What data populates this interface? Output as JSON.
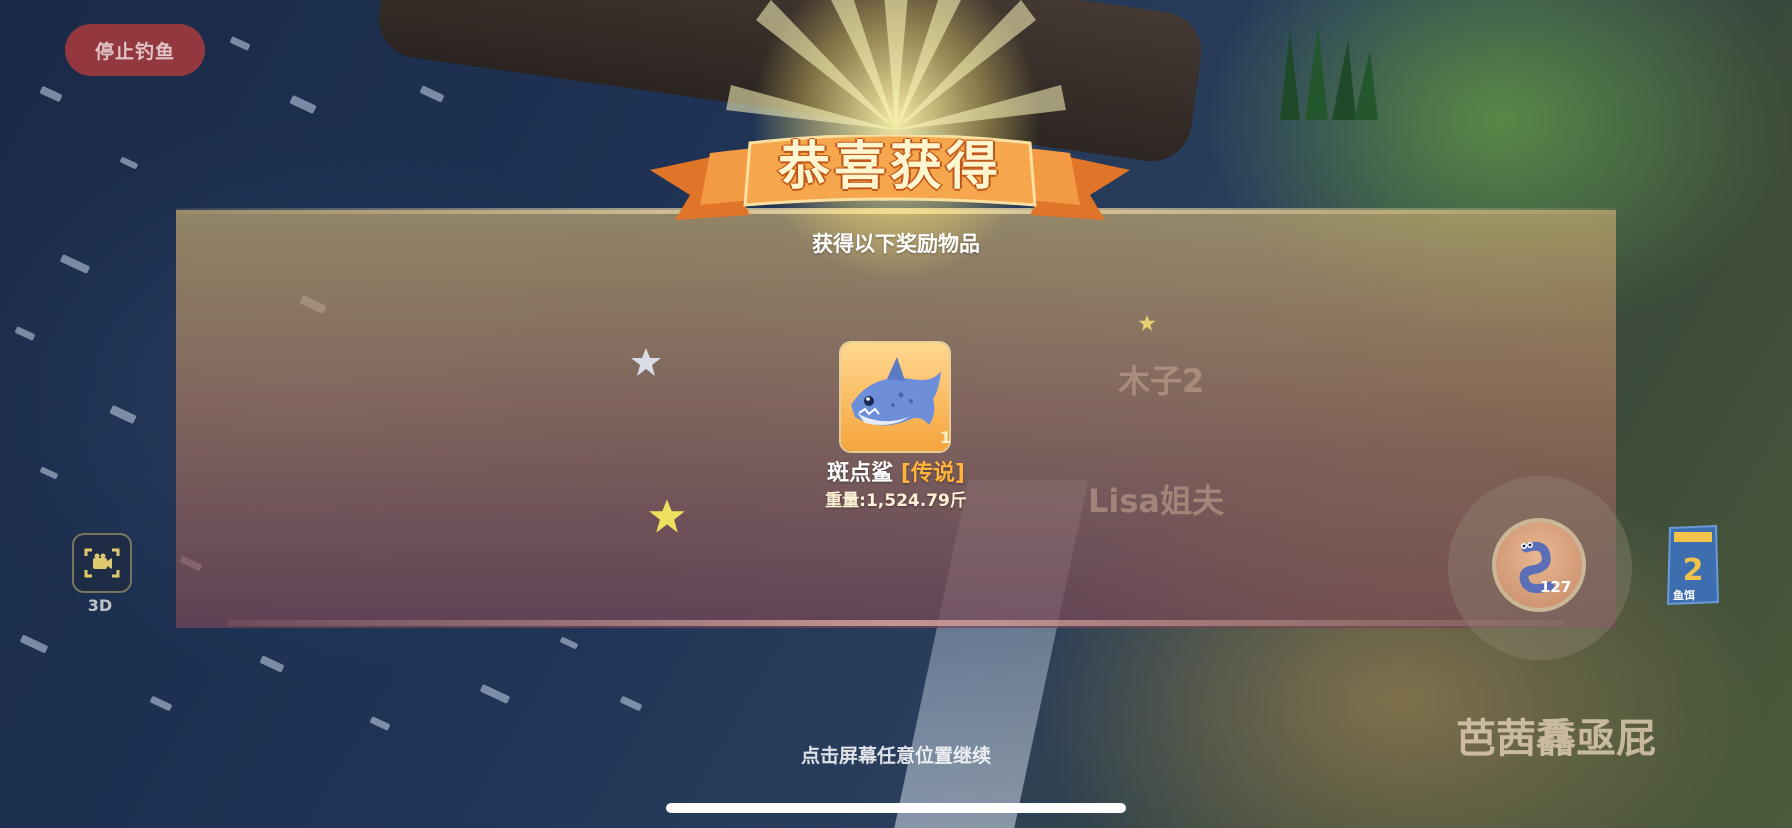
{
  "hud": {
    "stop_fishing_label": "停止钓鱼",
    "camera_mode_label": "3D"
  },
  "reward_popup": {
    "title": "恭喜获得",
    "subtitle": "获得以下奖励物品",
    "item": {
      "name": "斑点鲨",
      "rarity": "[传说]",
      "count": "1",
      "weight": "重量:1,524.79斤",
      "icon": "shark-icon"
    },
    "continue_hint": "点击屏幕任意位置继续"
  },
  "players": {
    "names": [
      "木子2",
      "Lisa姐夫",
      "芭茜馫亟屁"
    ]
  },
  "bait": {
    "count": "127",
    "bag_label": "鱼饵",
    "bag_number": "2"
  },
  "colors": {
    "title_text": "#fff6cf",
    "title_outline": "#c0571a",
    "rarity_legendary": "#ffb23c",
    "stop_button": "#be3c3c",
    "ribbon": "#f08a3a"
  }
}
